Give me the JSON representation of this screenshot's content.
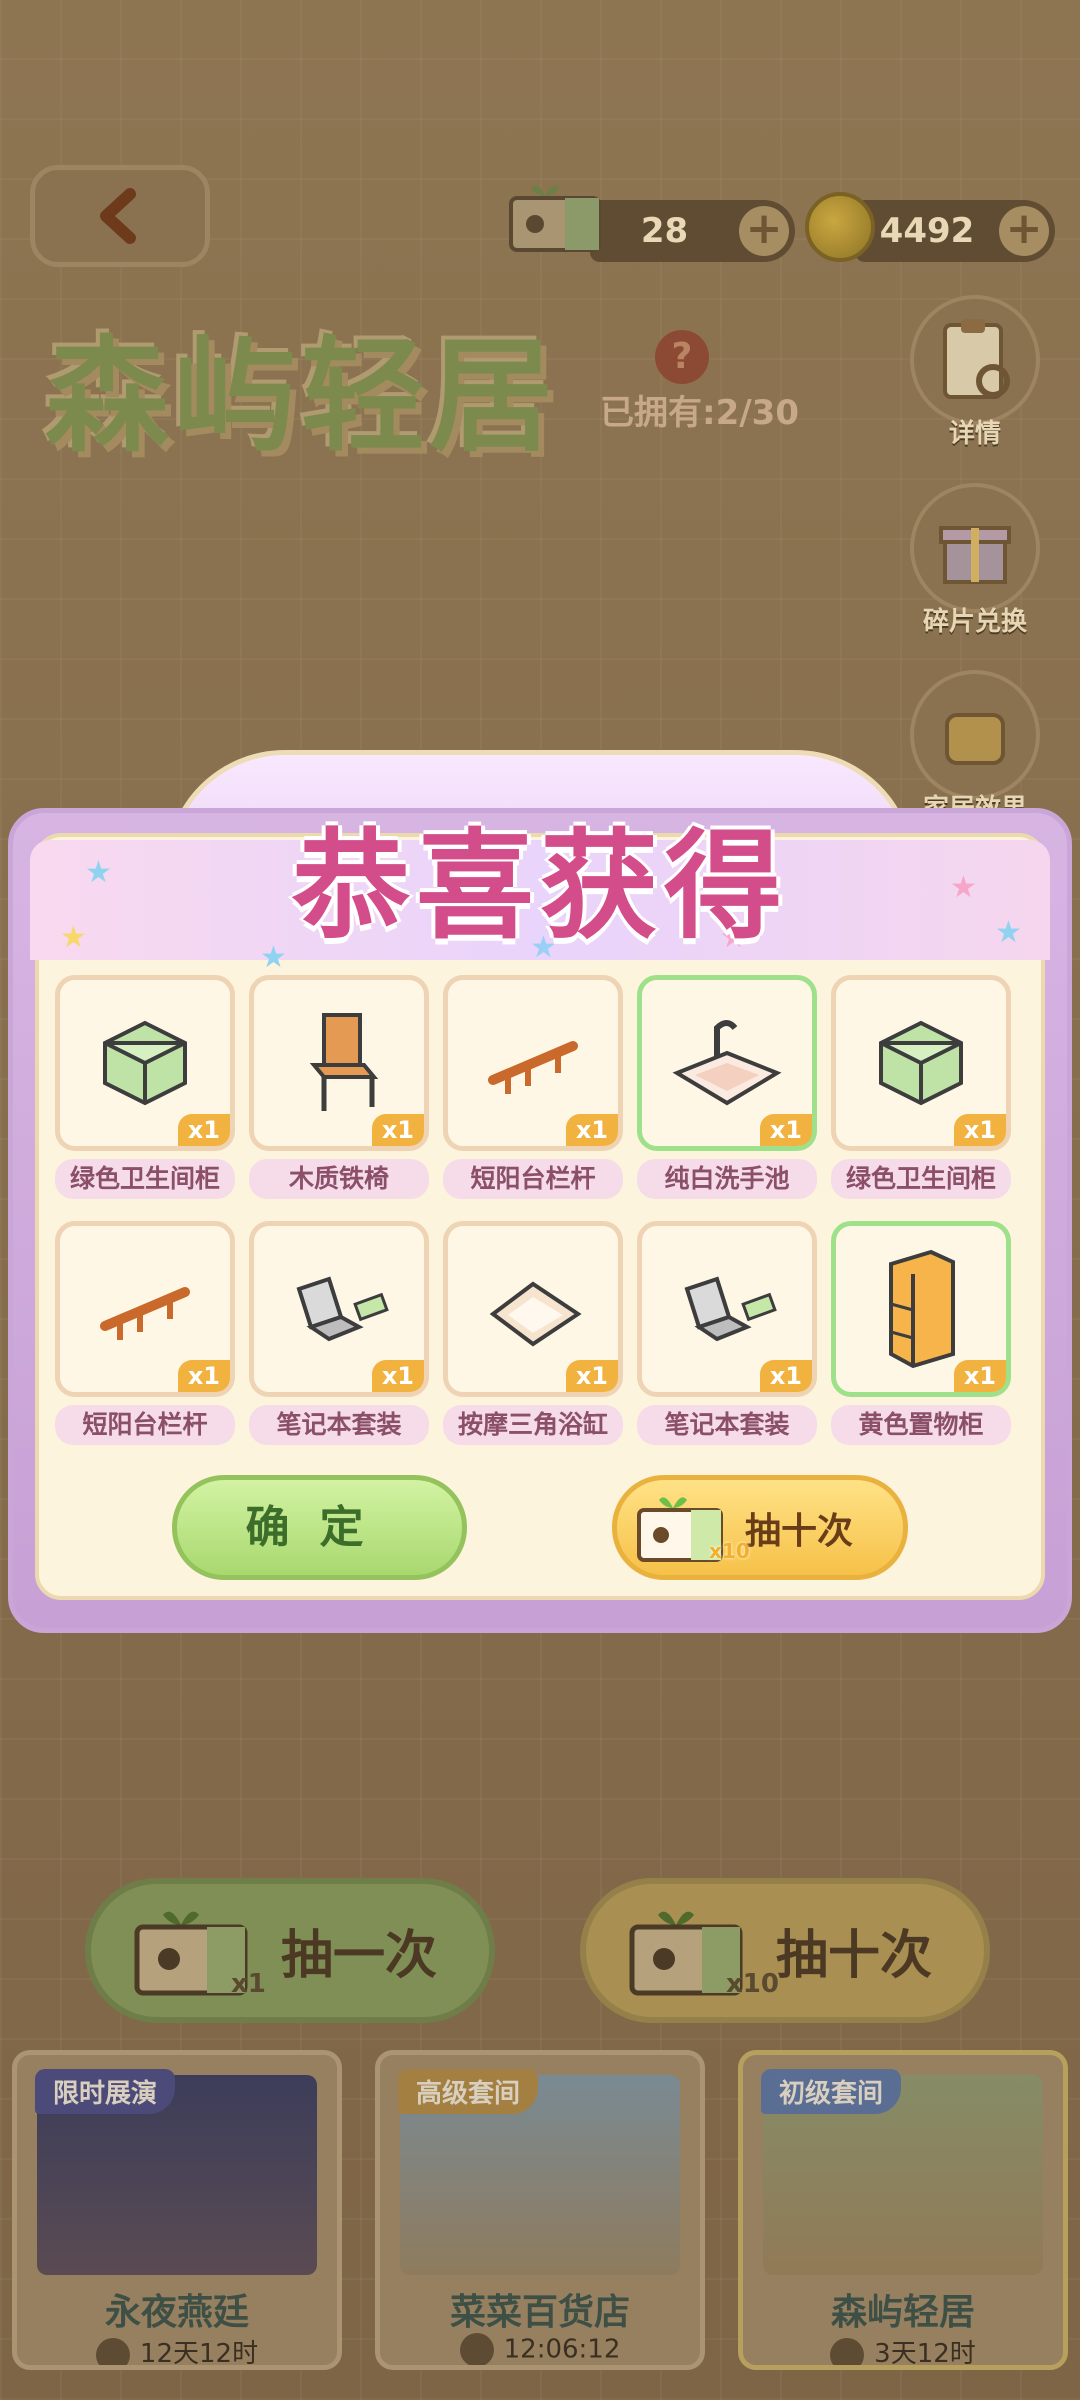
{
  "header": {
    "back_icon": "chevron-left-icon",
    "tickets": "28",
    "coins": "4492",
    "plus_label": "+"
  },
  "banner": {
    "title": "森屿轻居",
    "owned": "已拥有:2/30",
    "help_label": "?"
  },
  "side": {
    "details": "详情",
    "exchange": "碎片兑换",
    "effect": "家居效果"
  },
  "modal": {
    "title": "恭喜获得",
    "items": [
      {
        "name": "绿色卫生间柜",
        "qty": "x1",
        "icon": "green-cabinet-icon",
        "rare": false
      },
      {
        "name": "木质铁椅",
        "qty": "x1",
        "icon": "chair-icon",
        "rare": false
      },
      {
        "name": "短阳台栏杆",
        "qty": "x1",
        "icon": "railing-icon",
        "rare": false
      },
      {
        "name": "纯白洗手池",
        "qty": "x1",
        "icon": "sink-icon",
        "rare": true
      },
      {
        "name": "绿色卫生间柜",
        "qty": "x1",
        "icon": "green-cabinet-icon",
        "rare": false
      },
      {
        "name": "短阳台栏杆",
        "qty": "x1",
        "icon": "railing-icon",
        "rare": false
      },
      {
        "name": "笔记本套装",
        "qty": "x1",
        "icon": "laptop-icon",
        "rare": false
      },
      {
        "name": "按摩三角浴缸",
        "qty": "x1",
        "icon": "bathtub-icon",
        "rare": false
      },
      {
        "name": "笔记本套装",
        "qty": "x1",
        "icon": "laptop-icon",
        "rare": false
      },
      {
        "name": "黄色置物柜",
        "qty": "x1",
        "icon": "yellow-cabinet-icon",
        "rare": true
      }
    ],
    "confirm_label": "确定",
    "draw_ten_label": "抽十次",
    "draw_ten_mult": "x10"
  },
  "draw": {
    "once_label": "抽一次",
    "once_mult": "x1",
    "ten_label": "抽十次",
    "ten_mult": "x10"
  },
  "cards": [
    {
      "tag": "限时展演",
      "name": "永夜燕廷",
      "timer": "12天12时",
      "tag_color": "#4b4a78"
    },
    {
      "tag": "高级套间",
      "name": "菜菜百货店",
      "timer": "12:06:12",
      "tag_color": "#a38042"
    },
    {
      "tag": "初级套间",
      "name": "森屿轻居",
      "timer": "3天12时",
      "tag_color": "#5a6d93"
    }
  ]
}
